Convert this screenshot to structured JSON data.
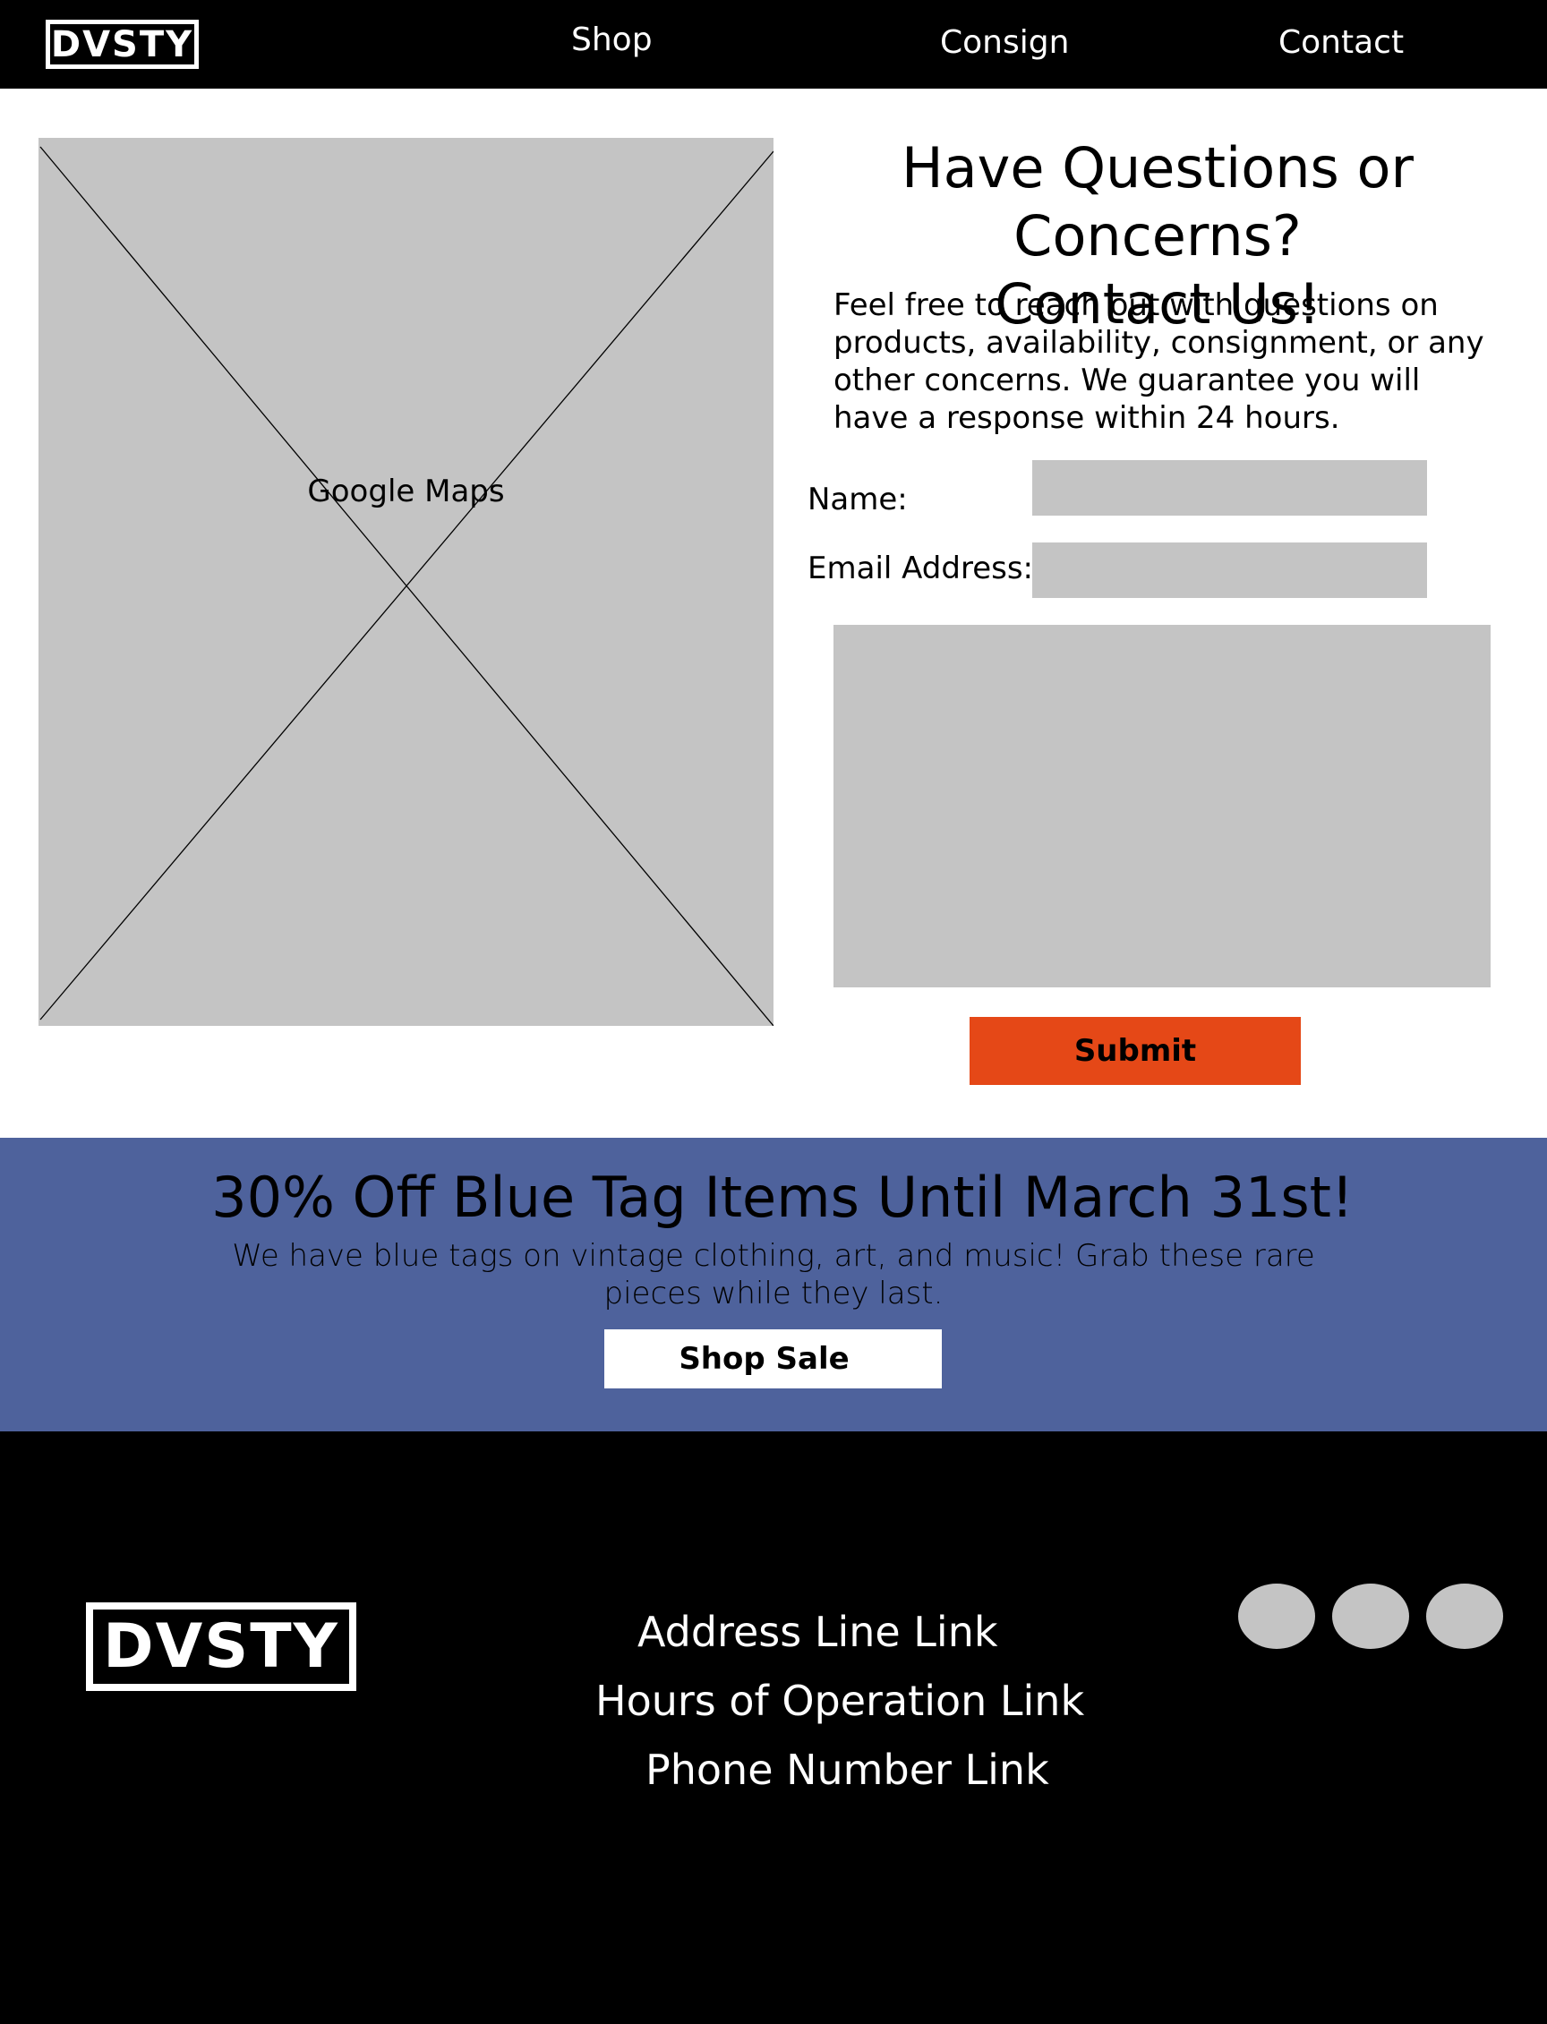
{
  "header": {
    "logo": "DVSTY",
    "nav": [
      {
        "label": "Shop"
      },
      {
        "label": "Consign"
      },
      {
        "label": "Contact"
      }
    ]
  },
  "map": {
    "label": "Google Maps"
  },
  "contact": {
    "heading_line1": "Have Questions or Concerns?",
    "heading_line2": "Contact Us!",
    "intro": "Feel free to reach out with questions on products, availability, consignment, or any other concerns. We guarantee you will have a response within 24 hours.",
    "name_label": "Name:",
    "email_label": "Email Address:",
    "submit_label": "Submit",
    "submit_color": "#e54817"
  },
  "promo": {
    "title": "30% Off Blue Tag Items Until March 31st!",
    "text": "We have blue tags on vintage clothing, art, and music! Grab these rare pieces while they last.",
    "button_label": "Shop Sale",
    "background": "#4e629c"
  },
  "footer": {
    "logo": "DVSTY",
    "links": [
      {
        "label": "Address Line Link"
      },
      {
        "label": "Hours of Operation Link"
      },
      {
        "label": "Phone Number Link"
      }
    ],
    "social_icons": [
      "social-icon-1",
      "social-icon-2",
      "social-icon-3"
    ]
  }
}
